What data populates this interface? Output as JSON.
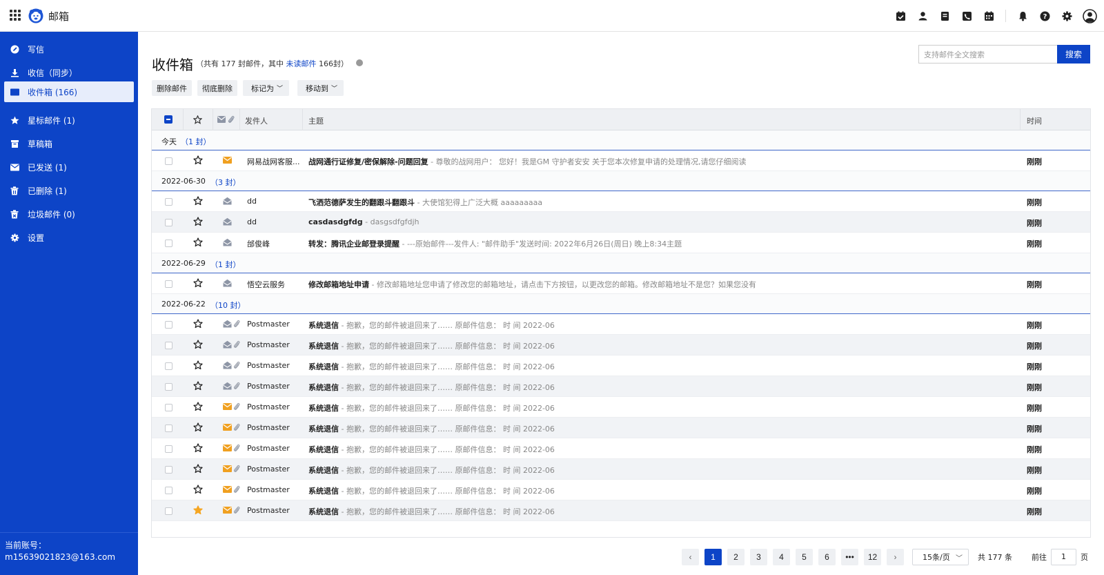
{
  "app": {
    "title": "邮箱"
  },
  "sidebar": {
    "items": [
      {
        "label": "写信",
        "icon": "compose-icon",
        "active": false
      },
      {
        "label": "收信（同步）",
        "icon": "download-icon",
        "active": false
      },
      {
        "label": "收件箱 (166)",
        "icon": "envelope-icon",
        "active": true
      },
      {
        "label": "星标邮件 (1)",
        "icon": "star-icon",
        "active": false
      },
      {
        "label": "草稿箱",
        "icon": "drafts-icon",
        "active": false
      },
      {
        "label": "已发送 (1)",
        "icon": "sent-icon",
        "active": false
      },
      {
        "label": "已删除 (1)",
        "icon": "trash-icon",
        "active": false
      },
      {
        "label": "垃圾邮件 (0)",
        "icon": "spam-icon",
        "active": false
      },
      {
        "label": "设置",
        "icon": "gear-icon",
        "active": false
      }
    ],
    "account_label": "当前账号：",
    "account_email": "m15639021823@163.com"
  },
  "main": {
    "title": "收件箱",
    "sub_prefix": "（共有 177 封邮件，其中 ",
    "sub_link": "未读邮件",
    "sub_suffix": " 166封）",
    "toolbar": {
      "delete": "删除邮件",
      "purge": "彻底删除",
      "mark": "标记为",
      "move": "移动到"
    },
    "search": {
      "placeholder": "支持邮件全文搜索",
      "button": "搜索"
    }
  },
  "table": {
    "headers": {
      "sender": "发件人",
      "subject": "主题",
      "time": "时间"
    },
    "groups": [
      {
        "date": "今天",
        "count": "（1 封）",
        "rows": [
          {
            "sender": "网易战网客服...",
            "subject": "战网通行证修复/密保解除-问题回复",
            "preview": " - 尊敬的战网用户： 您好！我是GM 守护者安安 关于您本次修复申请的处理情况,请您仔细阅读",
            "time": "刚刚",
            "mail": "unread",
            "clip": false,
            "starred": false
          }
        ]
      },
      {
        "date": "2022-06-30",
        "count": "（3 封）",
        "rows": [
          {
            "sender": "dd",
            "subject": "飞洒范德萨发生的翻跟斗翻跟斗",
            "preview": " - 大使馆犯得上广泛大概 aaaaaaaaa",
            "time": "刚刚",
            "mail": "read",
            "clip": false,
            "starred": false
          },
          {
            "sender": "dd",
            "subject": "casdasdgfdg",
            "preview": " - dasgsdfgfdjh",
            "time": "刚刚",
            "mail": "read",
            "clip": false,
            "starred": false
          },
          {
            "sender": "邰俊峰",
            "subject": "转发：腾讯企业邮登录提醒",
            "preview": " - ---原始邮件---发件人: \"邮件助手\"发送时间: 2022年6月26日(周日) 晚上8:34主题",
            "time": "刚刚",
            "mail": "read",
            "clip": false,
            "starred": false
          }
        ]
      },
      {
        "date": "2022-06-29",
        "count": "（1 封）",
        "rows": [
          {
            "sender": "悟空云服务",
            "subject": "修改邮箱地址申请",
            "preview": " - 修改邮箱地址您申请了修改您的邮箱地址，请点击下方按钮，以更改您的邮箱。修改邮箱地址不是您？如果您没有",
            "time": "刚刚",
            "mail": "read",
            "clip": false,
            "starred": false
          }
        ]
      },
      {
        "date": "2022-06-22",
        "count": "（10 封）",
        "rows": [
          {
            "sender": "Postmaster",
            "subject": "系统退信",
            "preview": " - 抱歉，您的邮件被退回来了…… 原邮件信息： 时 间 2022-06",
            "time": "刚刚",
            "mail": "read",
            "clip": true,
            "starred": false
          },
          {
            "sender": "Postmaster",
            "subject": "系统退信",
            "preview": " - 抱歉，您的邮件被退回来了…… 原邮件信息： 时 间 2022-06",
            "time": "刚刚",
            "mail": "read",
            "clip": true,
            "starred": false
          },
          {
            "sender": "Postmaster",
            "subject": "系统退信",
            "preview": " - 抱歉，您的邮件被退回来了…… 原邮件信息： 时 间 2022-06",
            "time": "刚刚",
            "mail": "read",
            "clip": true,
            "starred": false
          },
          {
            "sender": "Postmaster",
            "subject": "系统退信",
            "preview": " - 抱歉，您的邮件被退回来了…… 原邮件信息： 时 间 2022-06",
            "time": "刚刚",
            "mail": "read",
            "clip": true,
            "starred": false
          },
          {
            "sender": "Postmaster",
            "subject": "系统退信",
            "preview": " - 抱歉，您的邮件被退回来了…… 原邮件信息： 时 间 2022-06",
            "time": "刚刚",
            "mail": "unread",
            "clip": true,
            "starred": false
          },
          {
            "sender": "Postmaster",
            "subject": "系统退信",
            "preview": " - 抱歉，您的邮件被退回来了…… 原邮件信息： 时 间 2022-06",
            "time": "刚刚",
            "mail": "unread",
            "clip": true,
            "starred": false
          },
          {
            "sender": "Postmaster",
            "subject": "系统退信",
            "preview": " - 抱歉，您的邮件被退回来了…… 原邮件信息： 时 间 2022-06",
            "time": "刚刚",
            "mail": "unread",
            "clip": true,
            "starred": false
          },
          {
            "sender": "Postmaster",
            "subject": "系统退信",
            "preview": " - 抱歉，您的邮件被退回来了…… 原邮件信息： 时 间 2022-06",
            "time": "刚刚",
            "mail": "unread",
            "clip": true,
            "starred": false
          },
          {
            "sender": "Postmaster",
            "subject": "系统退信",
            "preview": " - 抱歉，您的邮件被退回来了…… 原邮件信息： 时 间 2022-06",
            "time": "刚刚",
            "mail": "unread",
            "clip": true,
            "starred": false
          },
          {
            "sender": "Postmaster",
            "subject": "系统退信",
            "preview": " - 抱歉，您的邮件被退回来了…… 原邮件信息： 时 间 2022-06",
            "time": "刚刚",
            "mail": "unread",
            "clip": true,
            "starred": true
          }
        ]
      }
    ]
  },
  "pagination": {
    "prev": "‹",
    "next": "›",
    "pages": [
      "1",
      "2",
      "3",
      "4",
      "5",
      "6",
      "•••",
      "12"
    ],
    "current": "1",
    "page_size": "15条/页",
    "total": "共 177 条",
    "goto_label": "前往",
    "goto_value": "1",
    "goto_unit": "页"
  },
  "colors": {
    "brand": "#0d44c7",
    "unread_mail": "#f0a020",
    "read_mail": "#8e96a6",
    "star_active": "#f5a623"
  },
  "top_icons": [
    "check-calendar-icon",
    "contacts-icon",
    "notes-icon",
    "phone-icon",
    "calendar-icon",
    "bell-icon",
    "help-icon",
    "gear-icon",
    "user-avatar-icon"
  ]
}
